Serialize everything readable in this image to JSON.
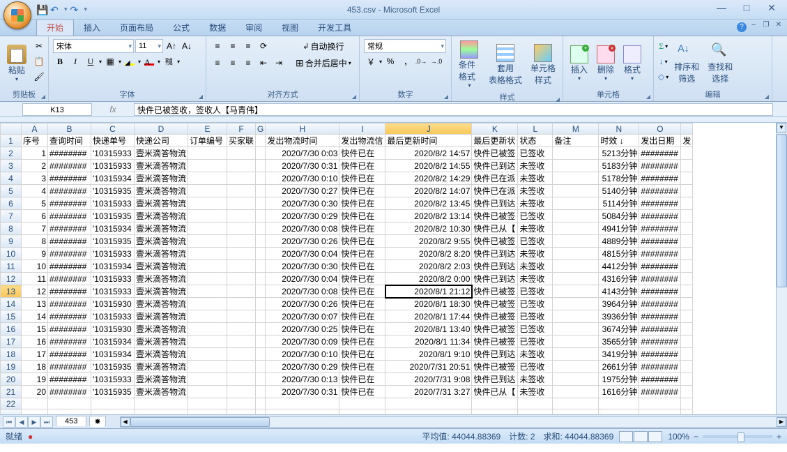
{
  "title": "453.csv - Microsoft Excel",
  "tabs": [
    "开始",
    "插入",
    "页面布局",
    "公式",
    "数据",
    "审阅",
    "视图",
    "开发工具"
  ],
  "active_tab": 0,
  "font": {
    "name": "宋体",
    "size": "11"
  },
  "number_format": "常规",
  "groups": {
    "clipboard": "剪贴板",
    "font": "字体",
    "alignment": "对齐方式",
    "number": "数字",
    "styles": "样式",
    "cells": "单元格",
    "editing": "编辑",
    "paste": "粘贴",
    "wrap": "自动换行",
    "merge": "合并后居中",
    "cf": "条件格式",
    "fmt_tbl": "套用\n表格格式",
    "cell_style": "单元格\n样式",
    "insert": "插入",
    "delete": "删除",
    "format": "格式",
    "sort": "排序和\n筛选",
    "find": "查找和\n选择"
  },
  "namebox": "K13",
  "formula": "快件已被签收，签收人【马青伟】",
  "columns": [
    "",
    "A",
    "B",
    "C",
    "D",
    "E",
    "F",
    "G",
    "H",
    "I",
    "J",
    "K",
    "L",
    "M",
    "N",
    "O",
    ""
  ],
  "headers": {
    "A": "序号",
    "B": "查询时间",
    "C": "快递单号",
    "D": "快递公司",
    "E": "订单编号",
    "F": "买家联",
    "G": "",
    "H": "发出物流时间",
    "I": "发出物流信",
    "J": "最后更新时间",
    "K": "最后更新状",
    "L": "状态",
    "M": "备注",
    "N": "时效  ↓",
    "O": "发出日期",
    "P": "发"
  },
  "rows": [
    {
      "n": 1,
      "A": "1",
      "B": "########",
      "C": "'10315933",
      "D": "壹米滴答物流",
      "H": "2020/7/30 0:03",
      "I": "快件已在",
      "J": "2020/8/2 14:57",
      "K": "快件已被签",
      "L": "已签收",
      "N": "5213分钟",
      "O": "########"
    },
    {
      "n": 2,
      "A": "2",
      "B": "########",
      "C": "'10315933",
      "D": "壹米滴答物流",
      "H": "2020/7/30 0:31",
      "I": "快件已在",
      "J": "2020/8/2 14:55",
      "K": "快件已到达",
      "L": "未签收",
      "N": "5183分钟",
      "O": "########"
    },
    {
      "n": 3,
      "A": "3",
      "B": "########",
      "C": "'10315934",
      "D": "壹米滴答物流",
      "H": "2020/7/30 0:10",
      "I": "快件已在",
      "J": "2020/8/2 14:29",
      "K": "快件已在派",
      "L": "未签收",
      "N": "5178分钟",
      "O": "########"
    },
    {
      "n": 4,
      "A": "4",
      "B": "########",
      "C": "'10315935",
      "D": "壹米滴答物流",
      "H": "2020/7/30 0:27",
      "I": "快件已在",
      "J": "2020/8/2 14:07",
      "K": "快件已在派",
      "L": "未签收",
      "N": "5140分钟",
      "O": "########"
    },
    {
      "n": 5,
      "A": "5",
      "B": "########",
      "C": "'10315933",
      "D": "壹米滴答物流",
      "H": "2020/7/30 0:30",
      "I": "快件已在",
      "J": "2020/8/2 13:45",
      "K": "快件已到达",
      "L": "未签收",
      "N": "5114分钟",
      "O": "########"
    },
    {
      "n": 6,
      "A": "6",
      "B": "########",
      "C": "'10315935",
      "D": "壹米滴答物流",
      "H": "2020/7/30 0:29",
      "I": "快件已在",
      "J": "2020/8/2 13:14",
      "K": "快件已被签",
      "L": "已签收",
      "N": "5084分钟",
      "O": "########"
    },
    {
      "n": 7,
      "A": "7",
      "B": "########",
      "C": "'10315934",
      "D": "壹米滴答物流",
      "H": "2020/7/30 0:08",
      "I": "快件已在",
      "J": "2020/8/2 10:30",
      "K": "快件已从【",
      "L": "未签收",
      "N": "4941分钟",
      "O": "########"
    },
    {
      "n": 8,
      "A": "8",
      "B": "########",
      "C": "'10315935",
      "D": "壹米滴答物流",
      "H": "2020/7/30 0:26",
      "I": "快件已在",
      "J": "2020/8/2 9:55",
      "K": "快件已被签",
      "L": "已签收",
      "N": "4889分钟",
      "O": "########"
    },
    {
      "n": 9,
      "A": "9",
      "B": "########",
      "C": "'10315933",
      "D": "壹米滴答物流",
      "H": "2020/7/30 0:04",
      "I": "快件已在",
      "J": "2020/8/2 8:20",
      "K": "快件已到达",
      "L": "未签收",
      "N": "4815分钟",
      "O": "########"
    },
    {
      "n": 10,
      "A": "10",
      "B": "########",
      "C": "'10315934",
      "D": "壹米滴答物流",
      "H": "2020/7/30 0:30",
      "I": "快件已在",
      "J": "2020/8/2 2:03",
      "K": "快件已到达",
      "L": "未签收",
      "N": "4412分钟",
      "O": "########"
    },
    {
      "n": 11,
      "A": "11",
      "B": "########",
      "C": "'10315933",
      "D": "壹米滴答物流",
      "H": "2020/7/30 0:04",
      "I": "快件已在",
      "J": "2020/8/2 0:00",
      "K": "快件已到达",
      "L": "未签收",
      "N": "4316分钟",
      "O": "########"
    },
    {
      "n": 12,
      "A": "12",
      "B": "########",
      "C": "'10315933",
      "D": "壹米滴答物流",
      "H": "2020/7/30 0:08",
      "I": "快件已在",
      "J": "2020/8/1 21:12",
      "K": "快件已被签",
      "L": "已签收",
      "N": "4143分钟",
      "O": "########"
    },
    {
      "n": 13,
      "A": "13",
      "B": "########",
      "C": "'10315930",
      "D": "壹米滴答物流",
      "H": "2020/7/30 0:26",
      "I": "快件已在",
      "J": "2020/8/1 18:30",
      "K": "快件已被签",
      "L": "已签收",
      "N": "3964分钟",
      "O": "########"
    },
    {
      "n": 14,
      "A": "14",
      "B": "########",
      "C": "'10315933",
      "D": "壹米滴答物流",
      "H": "2020/7/30 0:07",
      "I": "快件已在",
      "J": "2020/8/1 17:44",
      "K": "快件已被签",
      "L": "已签收",
      "N": "3936分钟",
      "O": "########"
    },
    {
      "n": 15,
      "A": "15",
      "B": "########",
      "C": "'10315930",
      "D": "壹米滴答物流",
      "H": "2020/7/30 0:25",
      "I": "快件已在",
      "J": "2020/8/1 13:40",
      "K": "快件已被签",
      "L": "已签收",
      "N": "3674分钟",
      "O": "########"
    },
    {
      "n": 16,
      "A": "16",
      "B": "########",
      "C": "'10315934",
      "D": "壹米滴答物流",
      "H": "2020/7/30 0:09",
      "I": "快件已在",
      "J": "2020/8/1 11:34",
      "K": "快件已被签",
      "L": "已签收",
      "N": "3565分钟",
      "O": "########"
    },
    {
      "n": 17,
      "A": "17",
      "B": "########",
      "C": "'10315934",
      "D": "壹米滴答物流",
      "H": "2020/7/30 0:10",
      "I": "快件已在",
      "J": "2020/8/1 9:10",
      "K": "快件已到达",
      "L": "未签收",
      "N": "3419分钟",
      "O": "########"
    },
    {
      "n": 18,
      "A": "18",
      "B": "########",
      "C": "'10315935",
      "D": "壹米滴答物流",
      "H": "2020/7/30 0:29",
      "I": "快件已在",
      "J": "2020/7/31 20:51",
      "K": "快件已被签",
      "L": "已签收",
      "N": "2661分钟",
      "O": "########"
    },
    {
      "n": 19,
      "A": "19",
      "B": "########",
      "C": "'10315933",
      "D": "壹米滴答物流",
      "H": "2020/7/30 0:13",
      "I": "快件已在",
      "J": "2020/7/31 9:08",
      "K": "快件已到达",
      "L": "未签收",
      "N": "1975分钟",
      "O": "########"
    },
    {
      "n": 20,
      "A": "20",
      "B": "########",
      "C": "'10315935",
      "D": "壹米滴答物流",
      "H": "2020/7/30 0:31",
      "I": "快件已在",
      "J": "2020/7/31 3:27",
      "K": "快件已从【",
      "L": "未签收",
      "N": "1616分钟",
      "O": "########"
    }
  ],
  "selected_row": 13,
  "selected_col": "J",
  "sheet_name": "453",
  "status": {
    "ready": "就绪",
    "avg": "平均值: 44044.88369",
    "count": "计数: 2",
    "sum": "求和: 44044.88369",
    "zoom": "100%",
    "rec": "●"
  }
}
